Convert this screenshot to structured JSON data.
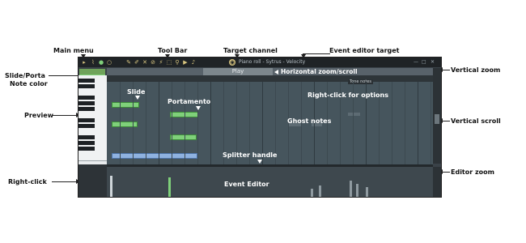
{
  "callouts": {
    "main_menu": "Main menu",
    "tool_bar": "Tool Bar",
    "target_channel": "Target channel",
    "event_editor_target": "Event editor target",
    "vertical_zoom": "Vertical zoom",
    "slide_porta": "Slide/Porta",
    "note_color": "Note color",
    "horizontal_zoom": "Horizontal zoom/scroll",
    "slide": "Slide",
    "portamento": "Portamento",
    "right_click_options": "Right-click for options",
    "preview": "Preview",
    "ghost_notes": "Ghost notes",
    "vertical_scroll": "Vertical scroll",
    "splitter_handle": "Splitter handle",
    "editor_zoom": "Editor zoom",
    "right_click": "Right-click",
    "event_editor": "Event Editor"
  },
  "window": {
    "title": "Piano roll - Sytrus - Velocity",
    "play_label": "Play",
    "tooltip": "Tone notes"
  },
  "colors": {
    "note": "#7fd07a",
    "blue_note": "#8fb2e0",
    "background": "#46555d"
  }
}
